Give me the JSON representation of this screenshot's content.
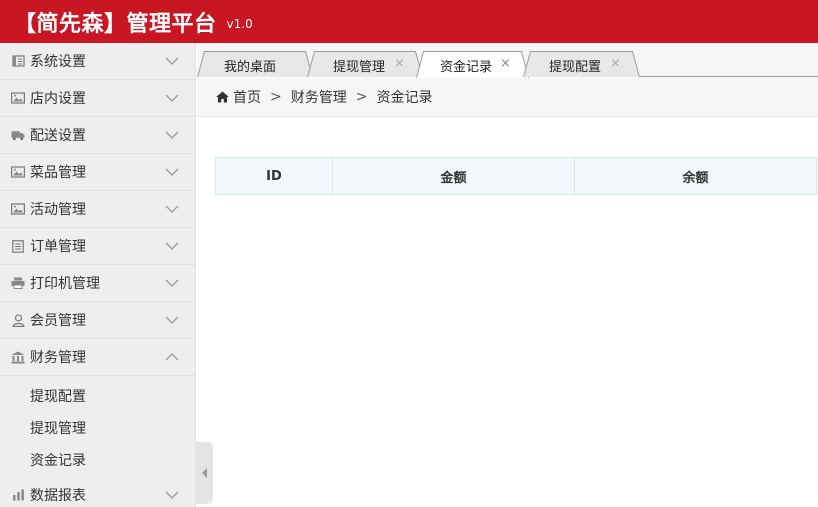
{
  "theme": {
    "brand": "#c91623"
  },
  "header": {
    "title": "【简先森】管理平台",
    "version": "v1.0"
  },
  "sidebar": {
    "items": [
      {
        "label": "系统设置",
        "icon": "document-icon",
        "expanded": false
      },
      {
        "label": "店内设置",
        "icon": "image-icon",
        "expanded": false
      },
      {
        "label": "配送设置",
        "icon": "truck-icon",
        "expanded": false
      },
      {
        "label": "菜品管理",
        "icon": "image-icon",
        "expanded": false
      },
      {
        "label": "活动管理",
        "icon": "image-icon",
        "expanded": false
      },
      {
        "label": "订单管理",
        "icon": "list-icon",
        "expanded": false
      },
      {
        "label": "打印机管理",
        "icon": "printer-icon",
        "expanded": false
      },
      {
        "label": "会员管理",
        "icon": "user-icon",
        "expanded": false
      },
      {
        "label": "财务管理",
        "icon": "bank-icon",
        "expanded": true
      },
      {
        "label": "数据报表",
        "icon": "chart-icon",
        "expanded": false
      }
    ],
    "submenu": [
      "提现配置",
      "提现管理",
      "资金记录"
    ]
  },
  "tabs": [
    {
      "label": "我的桌面",
      "close": ""
    },
    {
      "label": "提现管理",
      "close": "×"
    },
    {
      "label": "资金记录",
      "close": "×",
      "active": true
    },
    {
      "label": "提现配置",
      "close": "×"
    }
  ],
  "breadcrumb": {
    "home": "首页",
    "sep": ">",
    "level1": "财务管理",
    "level2": "资金记录"
  },
  "table": {
    "columns": [
      "ID",
      "金额",
      "余额"
    ]
  }
}
